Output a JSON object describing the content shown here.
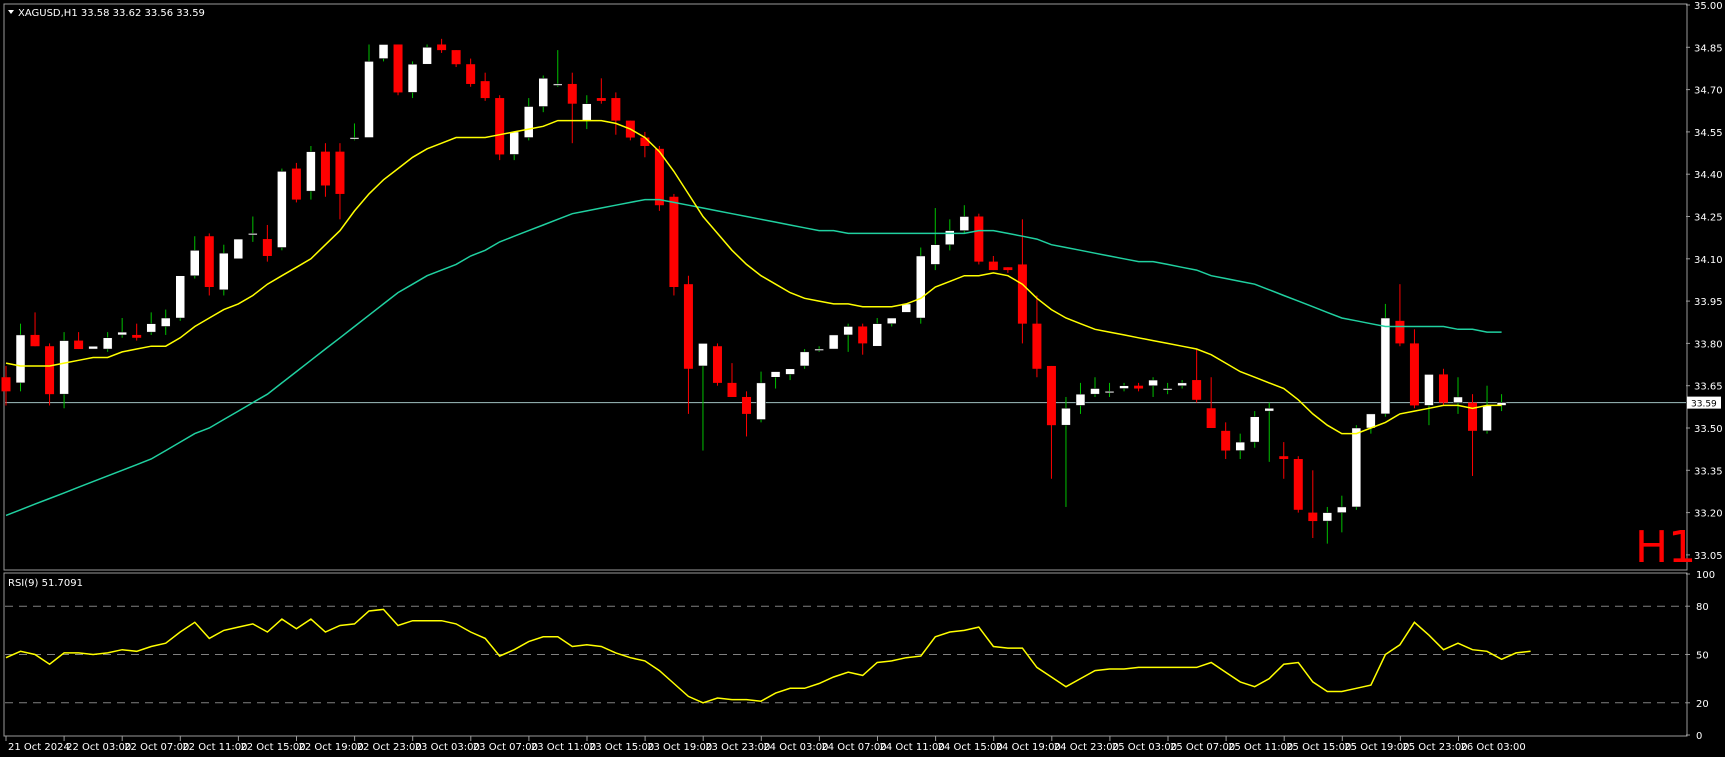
{
  "header": {
    "symbol_line": "XAGUSD,H1  33.58 33.62 33.56 33.59"
  },
  "timeframe_label": "H1",
  "rsi_panel": {
    "title": "RSI(9) 51.7091"
  },
  "colors": {
    "bull": "#ffffff",
    "bear": "#ff0000",
    "wick_bull": "#00c000",
    "wick_bear": "#ff0000",
    "ma_fast": "#ffff00",
    "ma_slow": "#20d0a0",
    "rsi": "#ffff00",
    "grid": "#808080",
    "price_line": "#a0c0c0",
    "h1": "#ff0000"
  },
  "chart_data": [
    {
      "type": "candlestick",
      "title": "XAGUSD,H1",
      "ylim": [
        33.0,
        35.0
      ],
      "y_ticks": [
        "35.00",
        "34.85",
        "34.70",
        "34.55",
        "34.40",
        "34.25",
        "34.10",
        "33.95",
        "33.80",
        "33.65",
        "33.50",
        "33.35",
        "33.20",
        "33.05"
      ],
      "last_price_label": "33.59",
      "last_price": 33.59,
      "x_ticks": [
        "21 Oct 2024",
        "22 Oct 03:00",
        "22 Oct 07:00",
        "22 Oct 11:00",
        "22 Oct 15:00",
        "22 Oct 19:00",
        "22 Oct 23:00",
        "23 Oct 03:00",
        "23 Oct 07:00",
        "23 Oct 11:00",
        "23 Oct 15:00",
        "23 Oct 19:00",
        "23 Oct 23:00",
        "24 Oct 03:00",
        "24 Oct 07:00",
        "24 Oct 11:00",
        "24 Oct 15:00",
        "24 Oct 19:00",
        "24 Oct 23:00",
        "25 Oct 03:00",
        "25 Oct 07:00",
        "25 Oct 11:00",
        "25 Oct 15:00",
        "25 Oct 19:00",
        "25 Oct 23:00",
        "26 Oct 03:00"
      ],
      "ohlc": [
        [
          33.68,
          33.72,
          33.58,
          33.63
        ],
        [
          33.66,
          33.87,
          33.63,
          33.83
        ],
        [
          33.83,
          33.91,
          33.79,
          33.79
        ],
        [
          33.79,
          33.8,
          33.58,
          33.62
        ],
        [
          33.62,
          33.84,
          33.57,
          33.81
        ],
        [
          33.81,
          33.84,
          33.78,
          33.78
        ],
        [
          33.78,
          33.79,
          33.78,
          33.79
        ],
        [
          33.78,
          33.84,
          33.77,
          33.82
        ],
        [
          33.83,
          33.89,
          33.82,
          33.84
        ],
        [
          33.83,
          33.87,
          33.81,
          33.82
        ],
        [
          33.84,
          33.91,
          33.83,
          33.87
        ],
        [
          33.86,
          33.92,
          33.83,
          33.89
        ],
        [
          33.89,
          34.04,
          33.88,
          34.04
        ],
        [
          34.04,
          34.18,
          34.03,
          34.13
        ],
        [
          34.18,
          34.19,
          33.97,
          34.0
        ],
        [
          33.99,
          34.15,
          33.97,
          34.12
        ],
        [
          34.1,
          34.17,
          34.1,
          34.17
        ],
        [
          34.19,
          34.25,
          34.16,
          34.19
        ],
        [
          34.17,
          34.22,
          34.09,
          34.11
        ],
        [
          34.14,
          34.42,
          34.13,
          34.41
        ],
        [
          34.42,
          34.44,
          34.3,
          34.31
        ],
        [
          34.34,
          34.5,
          34.31,
          34.48
        ],
        [
          34.48,
          34.51,
          34.32,
          34.36
        ],
        [
          34.48,
          34.51,
          34.24,
          34.33
        ],
        [
          34.53,
          34.58,
          34.52,
          34.53
        ],
        [
          34.53,
          34.86,
          34.53,
          34.8
        ],
        [
          34.81,
          34.86,
          34.8,
          34.86
        ],
        [
          34.86,
          34.86,
          34.68,
          34.69
        ],
        [
          34.69,
          34.8,
          34.67,
          34.79
        ],
        [
          34.79,
          34.86,
          34.79,
          34.85
        ],
        [
          34.86,
          34.88,
          34.83,
          34.84
        ],
        [
          34.84,
          34.84,
          34.78,
          34.79
        ],
        [
          34.79,
          34.81,
          34.71,
          34.72
        ],
        [
          34.73,
          34.76,
          34.66,
          34.67
        ],
        [
          34.67,
          34.68,
          34.45,
          34.47
        ],
        [
          34.47,
          34.54,
          34.45,
          34.55
        ],
        [
          34.53,
          34.67,
          34.52,
          34.64
        ],
        [
          34.64,
          34.75,
          34.62,
          34.74
        ],
        [
          34.72,
          34.84,
          34.71,
          34.72
        ],
        [
          34.72,
          34.76,
          34.51,
          34.65
        ],
        [
          34.59,
          34.68,
          34.56,
          34.65
        ],
        [
          34.67,
          34.74,
          34.65,
          34.66
        ],
        [
          34.67,
          34.69,
          34.54,
          34.59
        ],
        [
          34.59,
          34.59,
          34.52,
          34.53
        ],
        [
          34.53,
          34.55,
          34.46,
          34.5
        ],
        [
          34.49,
          34.5,
          34.27,
          34.29
        ],
        [
          34.32,
          34.33,
          33.97,
          34.0
        ],
        [
          34.01,
          34.04,
          33.55,
          33.71
        ],
        [
          33.72,
          33.79,
          33.42,
          33.8
        ],
        [
          33.79,
          33.8,
          33.65,
          33.66
        ],
        [
          33.66,
          33.73,
          33.61,
          33.61
        ],
        [
          33.61,
          33.63,
          33.47,
          33.55
        ],
        [
          33.53,
          33.7,
          33.52,
          33.66
        ],
        [
          33.68,
          33.7,
          33.64,
          33.7
        ],
        [
          33.69,
          33.71,
          33.67,
          33.71
        ],
        [
          33.72,
          33.78,
          33.71,
          33.77
        ],
        [
          33.78,
          33.79,
          33.77,
          33.78
        ],
        [
          33.78,
          33.81,
          33.78,
          33.83
        ],
        [
          33.83,
          33.87,
          33.77,
          33.86
        ],
        [
          33.86,
          33.87,
          33.76,
          33.8
        ],
        [
          33.79,
          33.89,
          33.79,
          33.87
        ],
        [
          33.87,
          33.89,
          33.86,
          33.89
        ],
        [
          33.91,
          33.94,
          33.92,
          33.94
        ],
        [
          33.89,
          34.14,
          33.87,
          34.11
        ],
        [
          34.08,
          34.28,
          34.06,
          34.15
        ],
        [
          34.15,
          34.24,
          34.13,
          34.2
        ],
        [
          34.2,
          34.29,
          34.19,
          34.25
        ],
        [
          34.25,
          34.26,
          34.08,
          34.09
        ],
        [
          34.09,
          34.11,
          34.06,
          34.06
        ],
        [
          34.07,
          34.07,
          34.05,
          34.06
        ],
        [
          34.08,
          34.24,
          33.8,
          33.87
        ],
        [
          33.87,
          33.97,
          33.68,
          33.71
        ],
        [
          33.72,
          33.72,
          33.32,
          33.51
        ],
        [
          33.51,
          33.61,
          33.22,
          33.57
        ],
        [
          33.58,
          33.66,
          33.55,
          33.62
        ],
        [
          33.62,
          33.68,
          33.61,
          33.64
        ],
        [
          33.63,
          33.66,
          33.61,
          33.63
        ],
        [
          33.64,
          33.66,
          33.63,
          33.65
        ],
        [
          33.65,
          33.66,
          33.63,
          33.64
        ],
        [
          33.65,
          33.68,
          33.61,
          33.67
        ],
        [
          33.64,
          33.66,
          33.62,
          33.64
        ],
        [
          33.65,
          33.67,
          33.64,
          33.66
        ],
        [
          33.67,
          33.78,
          33.59,
          33.6
        ],
        [
          33.57,
          33.68,
          33.5,
          33.5
        ],
        [
          33.49,
          33.52,
          33.39,
          33.42
        ],
        [
          33.42,
          33.48,
          33.39,
          33.45
        ],
        [
          33.45,
          33.56,
          33.43,
          33.54
        ],
        [
          33.56,
          33.59,
          33.38,
          33.57
        ],
        [
          33.4,
          33.45,
          33.32,
          33.39
        ],
        [
          33.39,
          33.4,
          33.2,
          33.21
        ],
        [
          33.2,
          33.35,
          33.11,
          33.17
        ],
        [
          33.17,
          33.22,
          33.09,
          33.2
        ],
        [
          33.2,
          33.26,
          33.13,
          33.22
        ],
        [
          33.22,
          33.51,
          33.21,
          33.5
        ],
        [
          33.5,
          33.55,
          33.48,
          33.55
        ],
        [
          33.55,
          33.94,
          33.54,
          33.89
        ],
        [
          33.88,
          34.01,
          33.79,
          33.8
        ],
        [
          33.8,
          33.85,
          33.57,
          33.58
        ],
        [
          33.58,
          33.63,
          33.51,
          33.69
        ],
        [
          33.69,
          33.71,
          33.58,
          33.59
        ],
        [
          33.59,
          33.68,
          33.55,
          33.61
        ],
        [
          33.59,
          33.62,
          33.33,
          33.49
        ],
        [
          33.49,
          33.65,
          33.48,
          33.58
        ],
        [
          33.58,
          33.62,
          33.56,
          33.59
        ]
      ],
      "ma_fast": [
        33.73,
        33.72,
        33.72,
        33.72,
        33.73,
        33.74,
        33.75,
        33.75,
        33.77,
        33.78,
        33.79,
        33.79,
        33.82,
        33.86,
        33.89,
        33.92,
        33.94,
        33.97,
        34.01,
        34.04,
        34.07,
        34.1,
        34.15,
        34.2,
        34.27,
        34.33,
        34.38,
        34.42,
        34.46,
        34.49,
        34.51,
        34.53,
        34.53,
        34.53,
        34.54,
        34.55,
        34.56,
        34.57,
        34.59,
        34.59,
        34.59,
        34.59,
        34.58,
        34.56,
        34.53,
        34.48,
        34.41,
        34.33,
        34.25,
        34.19,
        34.13,
        34.08,
        34.04,
        34.01,
        33.98,
        33.96,
        33.95,
        33.94,
        33.94,
        33.93,
        33.93,
        33.93,
        33.94,
        33.96,
        34.0,
        34.02,
        34.04,
        34.04,
        34.05,
        34.04,
        34.01,
        33.96,
        33.92,
        33.89,
        33.87,
        33.85,
        33.84,
        33.83,
        33.82,
        33.81,
        33.8,
        33.79,
        33.78,
        33.76,
        33.73,
        33.7,
        33.68,
        33.66,
        33.64,
        33.6,
        33.55,
        33.51,
        33.48,
        33.48,
        33.5,
        33.52,
        33.55,
        33.56,
        33.57,
        33.58,
        33.58,
        33.57,
        33.58,
        33.58
      ],
      "ma_slow": [
        33.19,
        33.21,
        33.23,
        33.25,
        33.27,
        33.29,
        33.31,
        33.33,
        33.35,
        33.37,
        33.39,
        33.42,
        33.45,
        33.48,
        33.5,
        33.53,
        33.56,
        33.59,
        33.62,
        33.66,
        33.7,
        33.74,
        33.78,
        33.82,
        33.86,
        33.9,
        33.94,
        33.98,
        34.01,
        34.04,
        34.06,
        34.08,
        34.11,
        34.13,
        34.16,
        34.18,
        34.2,
        34.22,
        34.24,
        34.26,
        34.27,
        34.28,
        34.29,
        34.3,
        34.31,
        34.31,
        34.3,
        34.29,
        34.28,
        34.27,
        34.26,
        34.25,
        34.24,
        34.23,
        34.22,
        34.21,
        34.2,
        34.2,
        34.19,
        34.19,
        34.19,
        34.19,
        34.19,
        34.19,
        34.19,
        34.19,
        34.19,
        34.2,
        34.2,
        34.19,
        34.18,
        34.17,
        34.15,
        34.14,
        34.13,
        34.12,
        34.11,
        34.1,
        34.09,
        34.09,
        34.08,
        34.07,
        34.06,
        34.04,
        34.03,
        34.02,
        34.01,
        33.99,
        33.97,
        33.95,
        33.93,
        33.91,
        33.89,
        33.88,
        33.87,
        33.86,
        33.86,
        33.86,
        33.86,
        33.86,
        33.85,
        33.85,
        33.84,
        33.84
      ]
    },
    {
      "type": "line",
      "title": "RSI(9) 51.7091",
      "ylim": [
        0,
        100
      ],
      "y_ticks": [
        "100",
        "80",
        "50",
        "20",
        "0"
      ],
      "levels": [
        80,
        50,
        20
      ],
      "values": [
        48,
        52,
        50,
        44,
        51,
        51,
        50,
        51,
        53,
        52,
        55,
        57,
        64,
        70,
        60,
        65,
        67,
        69,
        64,
        72,
        66,
        72,
        64,
        68,
        69,
        77,
        78,
        68,
        71,
        71,
        71,
        69,
        64,
        60,
        49,
        53,
        58,
        61,
        61,
        55,
        56,
        55,
        51,
        48,
        46,
        40,
        32,
        24,
        20,
        23,
        22,
        22,
        21,
        26,
        29,
        29,
        32,
        36,
        39,
        37,
        45,
        46,
        48,
        49,
        61,
        64,
        65,
        67,
        55,
        54,
        54,
        42,
        36,
        30,
        35,
        40,
        41,
        41,
        42,
        42,
        42,
        42,
        42,
        45,
        39,
        33,
        30,
        35,
        44,
        45,
        33,
        27,
        27,
        29,
        31,
        50,
        56,
        70,
        62,
        53,
        57,
        53,
        52,
        47,
        51,
        52
      ]
    }
  ]
}
